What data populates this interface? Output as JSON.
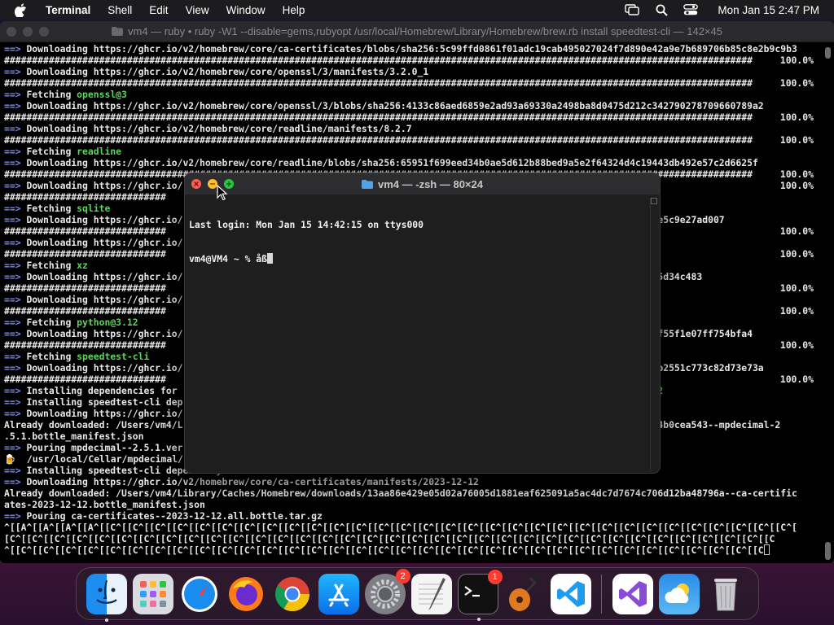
{
  "menubar": {
    "app_name": "Terminal",
    "items": [
      "Shell",
      "Edit",
      "View",
      "Window",
      "Help"
    ],
    "clock": "Mon Jan 15  2:47 PM",
    "icons": [
      "screen-mirroring-icon",
      "spotlight-search-icon",
      "control-center-icon"
    ]
  },
  "bg_terminal": {
    "title": "vm4 — ruby • ruby -W1 --disable=gems,rubyopt /usr/local/Homebrew/Library/Homebrew/brew.rb install speedtest-cli — 142×45",
    "lines": [
      {
        "a": "==> ",
        "t": "Downloading https://ghcr.io/v2/homebrew/core/ca-certificates/blobs/sha256:5c99ffd0861f01adc19cab495027024f7d890e42a9e7b689706b85c8e2b9c9b3",
        "p": ""
      },
      {
        "a": "",
        "t": "######################################################################################################################################",
        "p": "100.0%"
      },
      {
        "a": "==> ",
        "t": "Downloading https://ghcr.io/v2/homebrew/core/openssl/3/manifests/3.2.0_1",
        "p": ""
      },
      {
        "a": "",
        "t": "######################################################################################################################################",
        "p": "100.0%"
      },
      {
        "a": "==> ",
        "t": "Fetching ",
        "g": "openssl@3",
        "p": ""
      },
      {
        "a": "==> ",
        "t": "Downloading https://ghcr.io/v2/homebrew/core/openssl/3/blobs/sha256:4133c86aed6859e2ad93a69330a2498ba8d0475d212c342790278709660789a2",
        "p": ""
      },
      {
        "a": "",
        "t": "######################################################################################################################################",
        "p": "100.0%"
      },
      {
        "a": "==> ",
        "t": "Downloading https://ghcr.io/v2/homebrew/core/readline/manifests/8.2.7",
        "p": ""
      },
      {
        "a": "",
        "t": "######################################################################################################################################",
        "p": "100.0%"
      },
      {
        "a": "==> ",
        "t": "Fetching ",
        "g": "readline",
        "p": ""
      },
      {
        "a": "==> ",
        "t": "Downloading https://ghcr.io/v2/homebrew/core/readline/blobs/sha256:65951f699eed34b0ae5d612b88bed9a5e2f64324d4c19443db492e57c2d6625f",
        "p": ""
      },
      {
        "a": "",
        "t": "######################################################################################################################################",
        "p": "100.0%"
      },
      {
        "a": "==> ",
        "t": "Downloading https://ghcr.io/",
        "p": "100.0%"
      },
      {
        "a": "",
        "t": "#############################",
        "p": ""
      },
      {
        "a": "==> ",
        "t": "Fetching ",
        "g": "sqlite",
        "p": ""
      },
      {
        "a": "==> ",
        "t": "Downloading https://ghcr.io/                                                                               c1d31de5c9e27ad007",
        "p": ""
      },
      {
        "a": "",
        "t": "#############################",
        "p": "100.0%"
      },
      {
        "a": "==> ",
        "t": "Downloading https://ghcr.io/",
        "p": ""
      },
      {
        "a": "",
        "t": "#############################",
        "p": "100.0%"
      },
      {
        "a": "==> ",
        "t": "Fetching ",
        "g": "xz",
        "p": ""
      },
      {
        "a": "==> ",
        "t": "Downloading https://ghcr.io/                                                                               4d57cb5d34c483",
        "p": ""
      },
      {
        "a": "",
        "t": "#############################",
        "p": "100.0%"
      },
      {
        "a": "==> ",
        "t": "Downloading https://ghcr.io/",
        "p": ""
      },
      {
        "a": "",
        "t": "#############################",
        "p": "100.0%"
      },
      {
        "a": "==> ",
        "t": "Fetching ",
        "g": "python@3.12",
        "p": ""
      },
      {
        "a": "==> ",
        "t": "Downloading https://ghcr.io/                                                                               9f9f27f55f1e07ff754bfa4",
        "p": ""
      },
      {
        "a": "",
        "t": "#############################",
        "p": "100.0%"
      },
      {
        "a": "==> ",
        "t": "Fetching ",
        "g": "speedtest-cli",
        "p": ""
      },
      {
        "a": "==> ",
        "t": "Downloading https://ghcr.io/                                                                               559f6eb2551c773c82d73e73a",
        "p": ""
      },
      {
        "a": "",
        "t": "#############################",
        "p": "100.0%"
      },
      {
        "a": "==> ",
        "t": "Installing dependencies for                                                                                ",
        "g2": "on@3.12",
        "p": ""
      },
      {
        "a": "==> ",
        "t": "Installing speedtest-cli dep",
        "p": ""
      },
      {
        "a": "==> ",
        "t": "Downloading https://ghcr.io/",
        "p": ""
      },
      {
        "a": "",
        "t": "Already downloaded: /Users/vm4/L                                                                                845154b0cea543--mpdecimal-2",
        "p": ""
      },
      {
        "a": "",
        "t": ".5.1.bottle_manifest.json",
        "p": ""
      },
      {
        "a": "==> ",
        "t": "Pouring mpdecimal--2.5.1.ver",
        "p": ""
      },
      {
        "a": "",
        "t": "🍺  /usr/local/Cellar/mpdecimal/",
        "p": ""
      },
      {
        "a": "==> ",
        "t": "Installing speedtest-cli dependency: ca-certificates",
        "p": ""
      },
      {
        "a": "==> ",
        "t": "Downloading https://ghcr.io/v2/homebrew/core/ca-certificates/manifests/2023-12-12",
        "p": ""
      },
      {
        "a": "",
        "t": "Already downloaded: /Users/vm4/Library/Caches/Homebrew/downloads/13aa86e429e05d02a76005d1881eaf625091a5ac4dc7d7674c706d12ba48796a--ca-certific",
        "p": ""
      },
      {
        "a": "",
        "t": "ates-2023-12-12.bottle_manifest.json",
        "p": ""
      },
      {
        "a": "==> ",
        "t": "Pouring ca-certificates--2023-12-12.all.bottle.tar.gz",
        "p": ""
      },
      {
        "a": "",
        "t": "^[[A^[[A^[[A^[[A^[[C^[[C^[[C^[[C^[[C^[[C^[[C^[[C^[[C^[[C^[[C^[[C^[[C^[[C^[[C^[[C^[[C^[[C^[[C^[[C^[[C^[[C^[[C^[[C^[[C^[[C^[[C^[[C^[[C^[[C^[[C^[",
        "p": ""
      },
      {
        "a": "",
        "t": "[C^[[C^[[C^[[C^[[C^[[C^[[C^[[C^[[C^[[C^[[C^[[C^[[C^[[C^[[C^[[C^[[C^[[C^[[C^[[C^[[C^[[C^[[C^[[C^[[C^[[C^[[C^[[C^[[C^[[C^[[C^[[C^[[C^[[C^[[C",
        "p": ""
      },
      {
        "a": "",
        "t": "^[[C^[[C^[[C^[[C^[[C^[[C^[[C^[[C^[[C^[[C^[[C^[[C^[[C^[[C^[[C^[[C^[[C^[[C^[[C^[[C^[[C^[[C^[[C^[[C^[[C^[[C^[[C^[[C^[[C^[[C^[[C^[[C^[[C^[[C",
        "p": "",
        "cur": true
      }
    ]
  },
  "front_terminal": {
    "title": "vm4 — -zsh — 80×24",
    "last_login": "Last login: Mon Jan 15 14:42:15 on ttys000",
    "prompt": "vm4@VM4 ~ % ",
    "input": "åß"
  },
  "dock": {
    "apps": [
      {
        "name": "finder",
        "label": "Finder",
        "running": true
      },
      {
        "name": "launchpad",
        "label": "Launchpad"
      },
      {
        "name": "safari",
        "label": "Safari"
      },
      {
        "name": "firefox",
        "label": "Firefox"
      },
      {
        "name": "chrome",
        "label": "Google Chrome"
      },
      {
        "name": "app-store",
        "label": "App Store"
      },
      {
        "name": "system-settings",
        "label": "System Settings",
        "badge": "2"
      },
      {
        "name": "textedit",
        "label": "TextEdit"
      },
      {
        "name": "terminal",
        "label": "Terminal",
        "badge": "1",
        "running": true
      },
      {
        "name": "garageband",
        "label": "GarageBand"
      },
      {
        "name": "vscode",
        "label": "Visual Studio Code"
      },
      {
        "name": "visual-studio",
        "label": "Visual Studio"
      },
      {
        "name": "weather",
        "label": "Weather"
      },
      {
        "name": "trash",
        "label": "Trash"
      }
    ]
  },
  "colors": {
    "arrow": "#6d8bf5",
    "green": "#5ed35e",
    "close": "#fe5f57",
    "minimize": "#febc2e",
    "zoom": "#28c840"
  }
}
